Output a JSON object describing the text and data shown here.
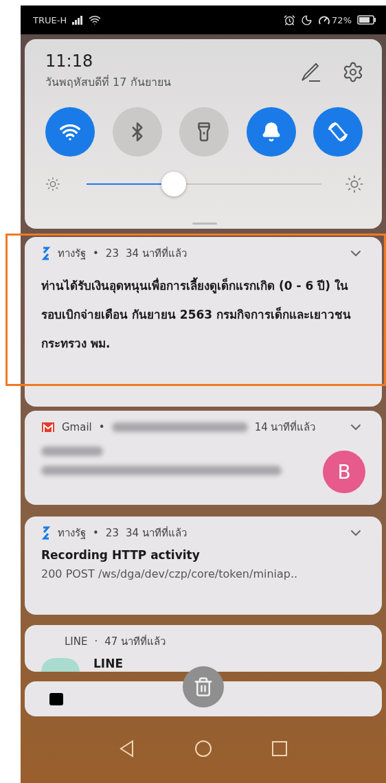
{
  "status_bar": {
    "carrier": "TRUE-H",
    "battery": "72%"
  },
  "quick_settings": {
    "time": "11:18",
    "date": "วันพฤหัสบดีที่ 17 กันยายน",
    "toggles": [
      {
        "kind": "wifi",
        "on": true
      },
      {
        "kind": "bluetooth",
        "on": false
      },
      {
        "kind": "flashlight",
        "on": false
      },
      {
        "kind": "bell",
        "on": true
      },
      {
        "kind": "rotate",
        "on": true
      }
    ],
    "brightness": {
      "level": 0.37
    }
  },
  "notifications": [
    {
      "kind": "tangrat",
      "app": "ทางรัฐ",
      "separator": "•",
      "sub_text": "23",
      "time": "34 นาทีที่แล้ว",
      "body": "ท่านได้รับเงินอุดหนุนเพื่อการเลี้ยงดูเด็กแรกเกิด (0 - 6 ปี) ในรอบเบิกจ่ายเดือน กันยายน 2563 กรมกิจการเด็กและเยาวชน กระทรวง พม.",
      "highlighted": true
    },
    {
      "kind": "gmail",
      "app": "Gmail",
      "separator": "•",
      "time": "14 นาทีที่แล้ว",
      "avatar": "B",
      "color": "#e65a8c"
    },
    {
      "kind": "tangrat",
      "app": "ทางรัฐ",
      "separator": "•",
      "sub_text": "23",
      "time": "34 นาทีที่แล้ว",
      "title": "Recording HTTP activity",
      "body": "200 POST /ws/dga/dev/czp/core/token/miniap.."
    },
    {
      "kind": "line",
      "app": "LINE",
      "separator": "·",
      "time": "47 นาทีที่แล้ว",
      "title": "LINE"
    },
    {
      "kind": "hms"
    }
  ]
}
